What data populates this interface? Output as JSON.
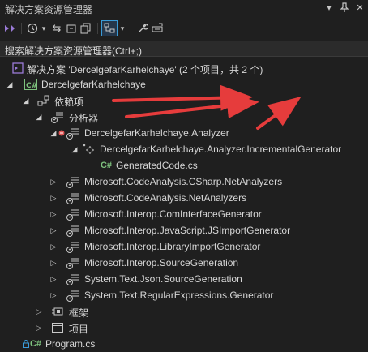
{
  "window": {
    "title": "解决方案资源管理器"
  },
  "search": {
    "placeholder": "搜索解决方案资源管理器(Ctrl+;)"
  },
  "tree": {
    "solution": "解决方案 'DercelgefarKarhelchaye' (2 个项目，共 2 个)",
    "project": "DercelgefarKarhelchaye",
    "dependencies": "依赖项",
    "analyzers": "分析器",
    "analyzer_main": "DercelgefarKarhelchaye.Analyzer",
    "generator": "DercelgefarKarhelchaye.Analyzer.IncrementalGenerator",
    "generated_file": "GeneratedCode.cs",
    "analyzer_list": [
      "Microsoft.CodeAnalysis.CSharp.NetAnalyzers",
      "Microsoft.CodeAnalysis.NetAnalyzers",
      "Microsoft.Interop.ComInterfaceGenerator",
      "Microsoft.Interop.JavaScript.JSImportGenerator",
      "Microsoft.Interop.LibraryImportGenerator",
      "Microsoft.Interop.SourceGeneration",
      "System.Text.Json.SourceGeneration",
      "System.Text.RegularExpressions.Generator"
    ],
    "frameworks": "框架",
    "projects": "项目",
    "program": "Program.cs"
  },
  "icons": {
    "solution": "solution-icon",
    "csproj": "csharp-project-icon",
    "dependencies": "dependencies-icon",
    "analyzer": "analyzer-icon",
    "generator": "generator-icon",
    "csfile": "csharp-file-icon"
  },
  "colors": {
    "background": "#1f1f1f",
    "text": "#d6d6d6",
    "arrow_red": "#e63c3c",
    "cs_green": "#7ec27e",
    "accent_blue": "#3a9bd8",
    "error_red": "#e05555",
    "solution_purple": "#9b7bd8"
  }
}
